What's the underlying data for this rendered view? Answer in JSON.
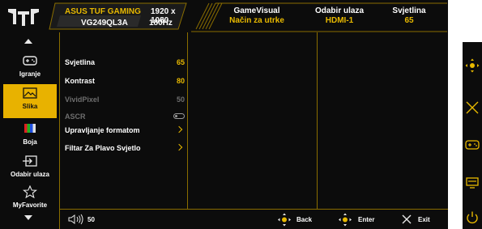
{
  "header": {
    "model_name": "ASUS TUF GAMING",
    "model_code": "VG249QL3A",
    "resolution": "1920 x 1080",
    "refresh": "180Hz",
    "status": [
      {
        "label": "GameVisual",
        "value": "Način za utrke"
      },
      {
        "label": "Odabir ulaza",
        "value": "HDMI-1"
      },
      {
        "label": "Svjetlina",
        "value": "65"
      }
    ]
  },
  "nav": {
    "items": [
      {
        "label": "Igranje",
        "icon": "gamepad-icon"
      },
      {
        "label": "Slika",
        "icon": "image-icon",
        "active": true
      },
      {
        "label": "Boja",
        "icon": "color-bars-icon"
      },
      {
        "label": "Odabir ulaza",
        "icon": "input-icon"
      },
      {
        "label": "MyFavorite",
        "icon": "star-icon"
      }
    ]
  },
  "menu": {
    "items": [
      {
        "label": "Svjetlina",
        "value": "65"
      },
      {
        "label": "Kontrast",
        "value": "80"
      },
      {
        "label": "VividPixel",
        "value": "50",
        "disabled": true
      },
      {
        "label": "ASCR",
        "control": "toggle",
        "disabled": true
      },
      {
        "label": "Upravljanje formatom",
        "control": "chevron"
      },
      {
        "label": "Filtar Za Plavo Svjetlo",
        "control": "chevron"
      }
    ]
  },
  "footer": {
    "volume": "50",
    "back": "Back",
    "enter": "Enter",
    "exit": "Exit"
  },
  "colors": {
    "accent": "#e8b900",
    "active_tab": "#e8b200",
    "background": "#0c0c0c",
    "divider": "#8a6d00"
  }
}
